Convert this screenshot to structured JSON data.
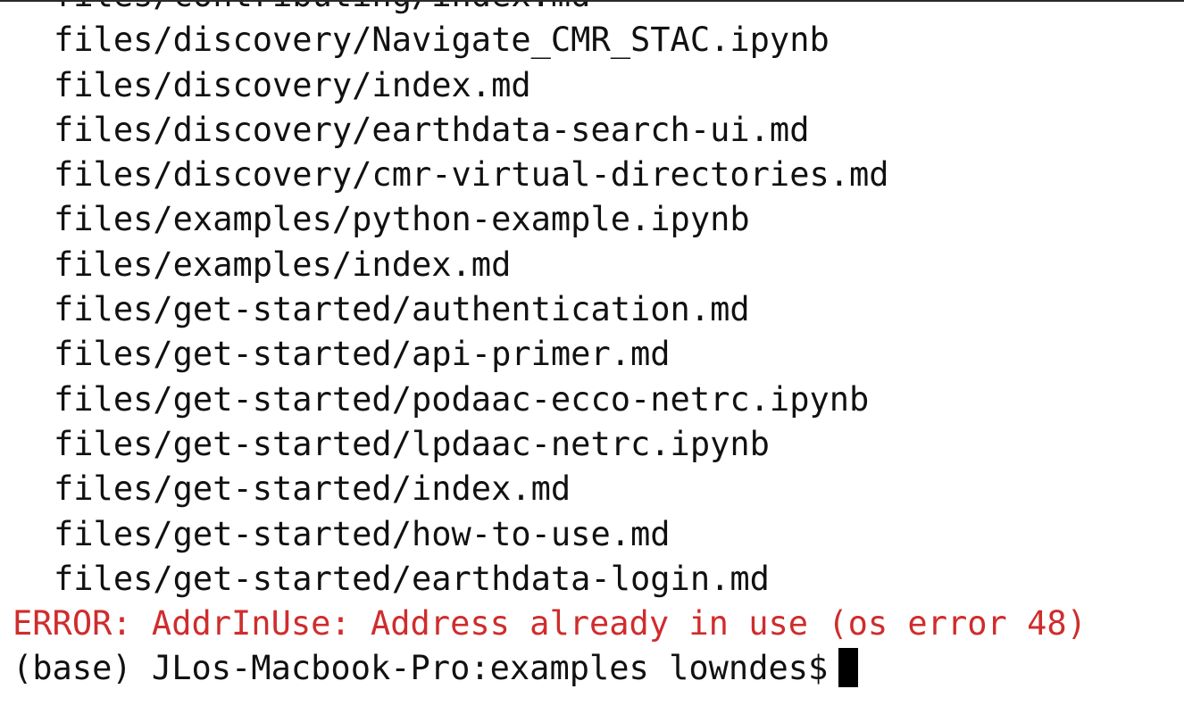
{
  "terminal": {
    "file_lines": [
      "files/contributing/index.md",
      "files/discovery/Navigate_CMR_STAC.ipynb",
      "files/discovery/index.md",
      "files/discovery/earthdata-search-ui.md",
      "files/discovery/cmr-virtual-directories.md",
      "files/examples/python-example.ipynb",
      "files/examples/index.md",
      "files/get-started/authentication.md",
      "files/get-started/api-primer.md",
      "files/get-started/podaac-ecco-netrc.ipynb",
      "files/get-started/lpdaac-netrc.ipynb",
      "files/get-started/index.md",
      "files/get-started/how-to-use.md",
      "files/get-started/earthdata-login.md"
    ],
    "error_line": "ERROR: AddrInUse: Address already in use (os error 48)",
    "prompt": "(base) JLos-Macbook-Pro:examples lowndes$"
  },
  "colors": {
    "background": "#ffffff",
    "text": "#111111",
    "error": "#d02c2c",
    "cursor": "#000000"
  }
}
